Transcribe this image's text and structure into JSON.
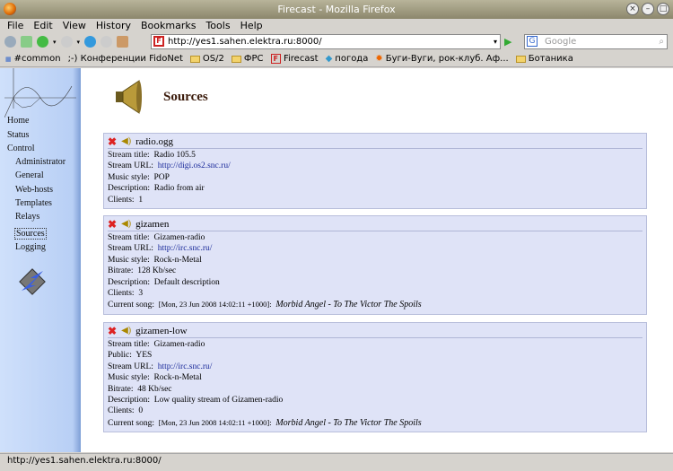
{
  "window": {
    "title": "Firecast - Mozilla Firefox"
  },
  "menu": [
    "File",
    "Edit",
    "View",
    "History",
    "Bookmarks",
    "Tools",
    "Help"
  ],
  "url": "http://yes1.sahen.elektra.ru:8000/",
  "search_placeholder": "Google",
  "bookmarks": [
    "#common",
    ";-) Конференции FidoNet",
    "OS/2",
    "ФРС",
    "Firecast",
    "погода",
    "Буги-Вуги, рок-клуб. Аф...",
    "Ботаника"
  ],
  "sidebar": {
    "items": [
      "Home",
      "Status",
      "Control",
      "Administrator",
      "General",
      "Web-hosts",
      "Templates",
      "Relays",
      "Sources",
      "Logging"
    ]
  },
  "page_title": "Sources",
  "sources": [
    {
      "name": "radio.ogg",
      "fields": [
        [
          "Stream title:",
          "Radio 105.5"
        ],
        [
          "Stream URL:",
          "http://digi.os2.snc.ru/"
        ],
        [
          "Music style:",
          "POP"
        ],
        [
          "Description:",
          "Radio from air"
        ],
        [
          "Clients:",
          "1"
        ]
      ]
    },
    {
      "name": "gizamen",
      "fields": [
        [
          "Stream title:",
          "Gizamen-radio"
        ],
        [
          "Stream URL:",
          "http://irc.snc.ru/"
        ],
        [
          "Music style:",
          "Rock-n-Metal"
        ],
        [
          "Bitrate:",
          "128 Kb/sec"
        ],
        [
          "Description:",
          "Default description"
        ],
        [
          "Clients:",
          "3"
        ]
      ],
      "current_song_label": "Current song:",
      "current_song_time": "[Mon, 23 Jun 2008 14:02:11 +1000]:",
      "current_song": "Morbid Angel - To The Victor The Spoils"
    },
    {
      "name": "gizamen-low",
      "fields": [
        [
          "Stream title:",
          "Gizamen-radio"
        ],
        [
          "Public:",
          "YES"
        ],
        [
          "Stream URL:",
          "http://irc.snc.ru/"
        ],
        [
          "Music style:",
          "Rock-n-Metal"
        ],
        [
          "Bitrate:",
          "48 Kb/sec"
        ],
        [
          "Description:",
          "Low quality stream of Gizamen-radio"
        ],
        [
          "Clients:",
          "0"
        ]
      ],
      "current_song_label": "Current song:",
      "current_song_time": "[Mon, 23 Jun 2008 14:02:11 +1000]:",
      "current_song": "Morbid Angel - To The Victor The Spoils"
    }
  ],
  "status_text": "http://yes1.sahen.elektra.ru:8000/"
}
